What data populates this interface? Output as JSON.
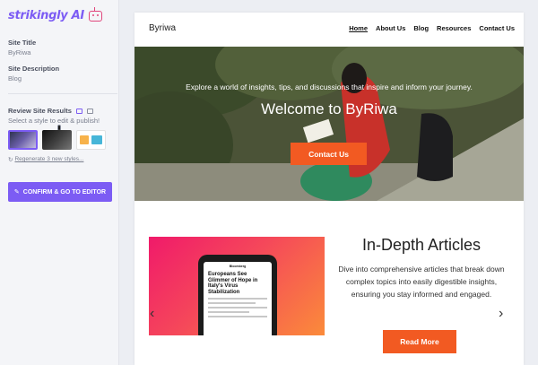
{
  "app": {
    "logo_text": "strikingly AI"
  },
  "left_panel": {
    "site_title_label": "Site Title",
    "site_title_value": "ByRiwa",
    "site_desc_label": "Site Description",
    "site_desc_value": "Blog",
    "review_label": "Review Site Results",
    "review_hint": "Select a style to edit & publish!",
    "regenerate_label": "Regenerate 3 new styles...",
    "confirm_label": "CONFIRM & GO TO EDITOR",
    "accent_color": "#7c5cf4"
  },
  "preview": {
    "brand": "Byriwa",
    "nav": [
      {
        "label": "Home",
        "active": true
      },
      {
        "label": "About Us"
      },
      {
        "label": "Blog"
      },
      {
        "label": "Resources"
      },
      {
        "label": "Contact Us"
      }
    ],
    "hero": {
      "subtitle": "Explore a world of insights, tips, and discussions that inspire and inform your journey.",
      "title": "Welcome to ByRiwa",
      "cta": "Contact Us"
    },
    "article": {
      "title": "In-Depth Articles",
      "description": "Dive into comprehensive articles that break down complex topics into easily digestible insights, ensuring you stay informed and engaged.",
      "cta": "Read More",
      "phone_source": "Bloomberg",
      "phone_headline": "Europeans See Glimmer of Hope in Italy's Virus Stabilization"
    },
    "cta_color": "#f25a22"
  }
}
